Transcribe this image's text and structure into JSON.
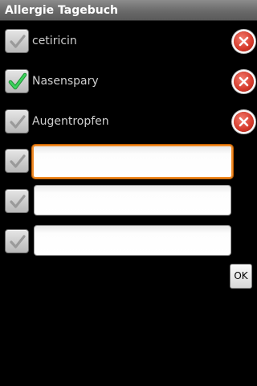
{
  "app": {
    "title": "Allergie Tagebuch"
  },
  "items": [
    {
      "label": "cetiricin",
      "checked": false
    },
    {
      "label": "Nasenspary",
      "checked": true
    },
    {
      "label": "Augentropfen",
      "checked": false
    }
  ],
  "new_entries": [
    {
      "value": "",
      "placeholder": "",
      "checked": false,
      "focused": true
    },
    {
      "value": "",
      "placeholder": "",
      "checked": false,
      "focused": false
    },
    {
      "value": "",
      "placeholder": "",
      "checked": false,
      "focused": false
    }
  ],
  "actions": {
    "ok_label": "OK"
  },
  "icons": {
    "checkbox_unchecked": "checkmark-grey-icon",
    "checkbox_checked": "checkmark-green-icon",
    "delete": "delete-circle-x-icon"
  },
  "colors": {
    "background": "#000000",
    "titlebar": "#6a6a6a",
    "check_green": "#2cb24a",
    "check_grey": "#8f8f8f",
    "delete_red": "#d63a2b",
    "focus_orange": "#f08a24"
  }
}
